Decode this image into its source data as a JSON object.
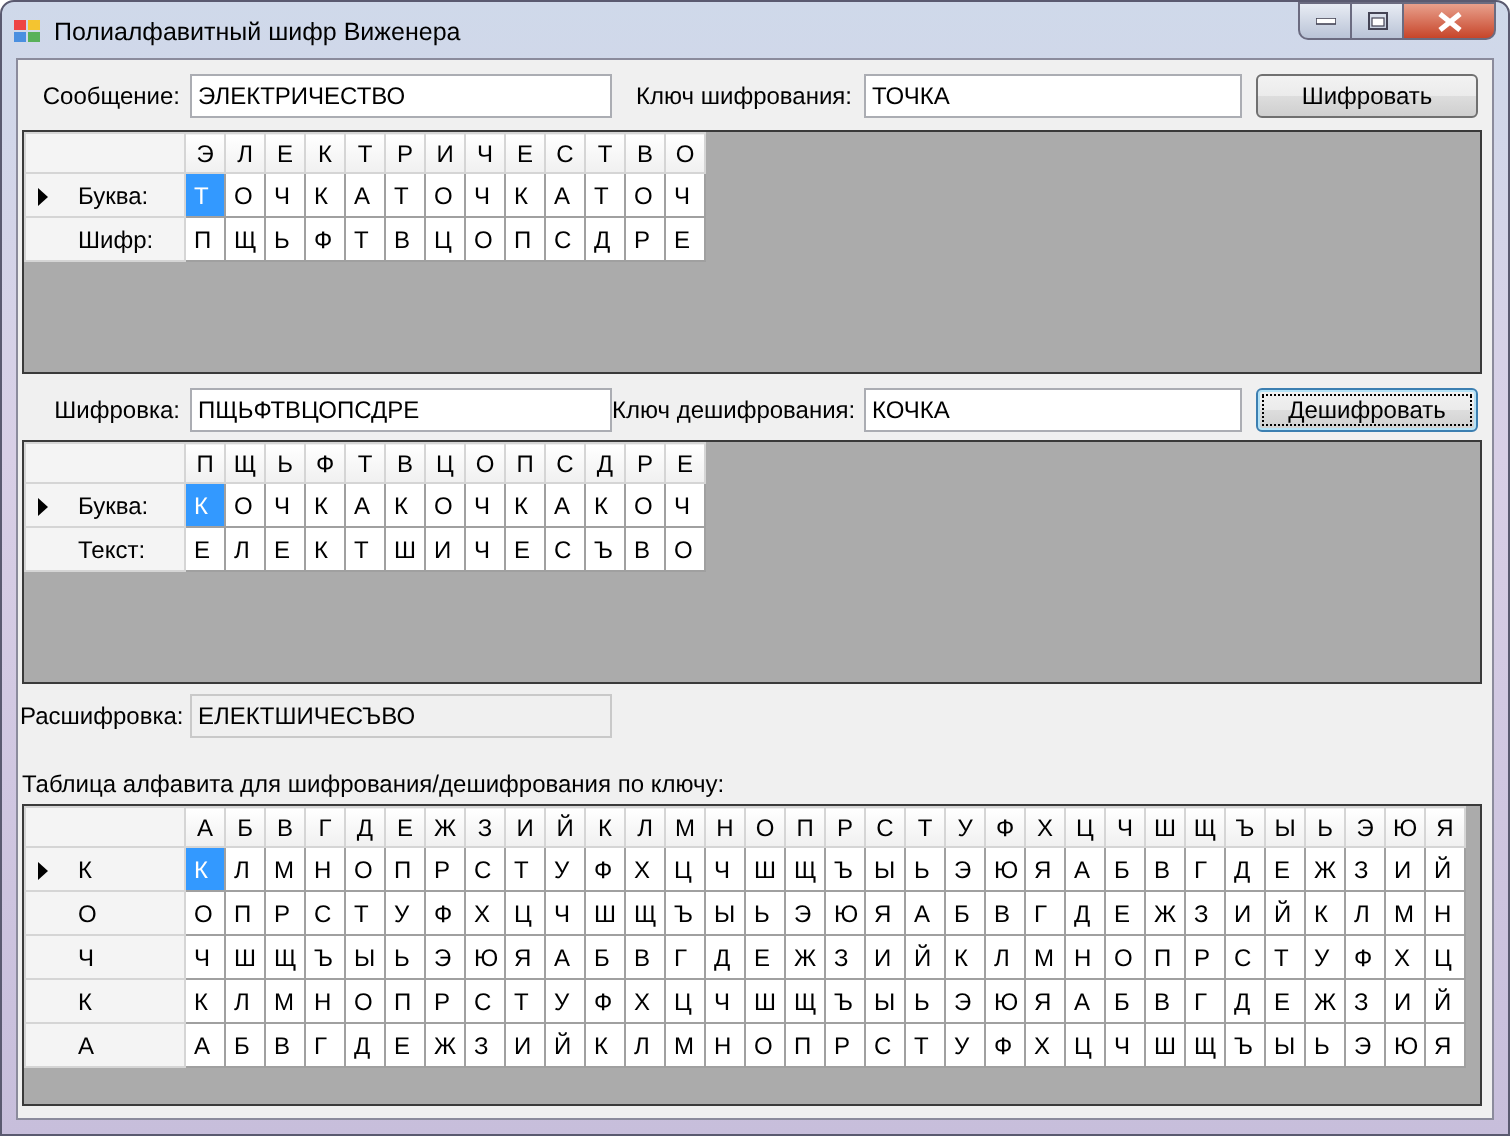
{
  "window": {
    "title": "Полиалфавитный шифр Виженера"
  },
  "encryption": {
    "message": {
      "label": "Сообщение:",
      "value": "ЭЛЕКТРИЧЕСТВО",
      "readonly": false
    },
    "key": {
      "label": "Ключ шифрования:",
      "value": "ТОЧКА",
      "readonly": false
    },
    "button": {
      "label": "Шифровать",
      "focused": false
    },
    "grid": {
      "columns": [
        "Э",
        "Л",
        "Е",
        "К",
        "Т",
        "Р",
        "И",
        "Ч",
        "Е",
        "С",
        "Т",
        "В",
        "О"
      ],
      "rows": [
        {
          "header": "Буква:",
          "selected": true,
          "cells": [
            {
              "text": "Т",
              "selected": true
            },
            {
              "text": "О",
              "selected": false
            },
            {
              "text": "Ч",
              "selected": false
            },
            {
              "text": "К",
              "selected": false
            },
            {
              "text": "А",
              "selected": false
            },
            {
              "text": "Т",
              "selected": false
            },
            {
              "text": "О",
              "selected": false
            },
            {
              "text": "Ч",
              "selected": false
            },
            {
              "text": "К",
              "selected": false
            },
            {
              "text": "А",
              "selected": false
            },
            {
              "text": "Т",
              "selected": false
            },
            {
              "text": "О",
              "selected": false
            },
            {
              "text": "Ч",
              "selected": false
            }
          ]
        },
        {
          "header": "Шифр:",
          "selected": false,
          "cells": [
            {
              "text": "П",
              "selected": false
            },
            {
              "text": "Щ",
              "selected": false
            },
            {
              "text": "Ь",
              "selected": false
            },
            {
              "text": "Ф",
              "selected": false
            },
            {
              "text": "Т",
              "selected": false
            },
            {
              "text": "В",
              "selected": false
            },
            {
              "text": "Ц",
              "selected": false
            },
            {
              "text": "О",
              "selected": false
            },
            {
              "text": "П",
              "selected": false
            },
            {
              "text": "С",
              "selected": false
            },
            {
              "text": "Д",
              "selected": false
            },
            {
              "text": "Р",
              "selected": false
            },
            {
              "text": "Е",
              "selected": false
            }
          ]
        }
      ]
    }
  },
  "decryption": {
    "cipher": {
      "label": "Шифровка:",
      "value": "ПЩЬФТВЦОПСДРЕ",
      "readonly": false
    },
    "key": {
      "label": "Ключ дешифрования:",
      "value": "КОЧКА",
      "readonly": false
    },
    "button": {
      "label": "Дешифровать",
      "focused": true
    },
    "grid": {
      "columns": [
        "П",
        "Щ",
        "Ь",
        "Ф",
        "Т",
        "В",
        "Ц",
        "О",
        "П",
        "С",
        "Д",
        "Р",
        "Е"
      ],
      "rows": [
        {
          "header": "Буква:",
          "selected": true,
          "cells": [
            {
              "text": "К",
              "selected": true
            },
            {
              "text": "О",
              "selected": false
            },
            {
              "text": "Ч",
              "selected": false
            },
            {
              "text": "К",
              "selected": false
            },
            {
              "text": "А",
              "selected": false
            },
            {
              "text": "К",
              "selected": false
            },
            {
              "text": "О",
              "selected": false
            },
            {
              "text": "Ч",
              "selected": false
            },
            {
              "text": "К",
              "selected": false
            },
            {
              "text": "А",
              "selected": false
            },
            {
              "text": "К",
              "selected": false
            },
            {
              "text": "О",
              "selected": false
            },
            {
              "text": "Ч",
              "selected": false
            }
          ]
        },
        {
          "header": "Текст:",
          "selected": false,
          "cells": [
            {
              "text": "Е",
              "selected": false
            },
            {
              "text": "Л",
              "selected": false
            },
            {
              "text": "Е",
              "selected": false
            },
            {
              "text": "К",
              "selected": false
            },
            {
              "text": "Т",
              "selected": false
            },
            {
              "text": "Ш",
              "selected": false
            },
            {
              "text": "И",
              "selected": false
            },
            {
              "text": "Ч",
              "selected": false
            },
            {
              "text": "Е",
              "selected": false
            },
            {
              "text": "С",
              "selected": false
            },
            {
              "text": "Ъ",
              "selected": false
            },
            {
              "text": "В",
              "selected": false
            },
            {
              "text": "О",
              "selected": false
            }
          ]
        }
      ]
    }
  },
  "result": {
    "label": "Расшифровка:",
    "value": "ЕЛЕКТШИЧЕСЪВО",
    "readonly": true
  },
  "alphabet_table": {
    "caption": "Таблица алфавита для шифрования/дешифрования по ключу:",
    "grid": {
      "columns": [
        "А",
        "Б",
        "В",
        "Г",
        "Д",
        "Е",
        "Ж",
        "З",
        "И",
        "Й",
        "К",
        "Л",
        "М",
        "Н",
        "О",
        "П",
        "Р",
        "С",
        "Т",
        "У",
        "Ф",
        "Х",
        "Ц",
        "Ч",
        "Ш",
        "Щ",
        "Ъ",
        "Ы",
        "Ь",
        "Э",
        "Ю",
        "Я"
      ],
      "rows": [
        {
          "header": "К",
          "selected": true,
          "cells": [
            {
              "text": "К",
              "selected": true
            },
            {
              "text": "Л",
              "selected": false
            },
            {
              "text": "М",
              "selected": false
            },
            {
              "text": "Н",
              "selected": false
            },
            {
              "text": "О",
              "selected": false
            },
            {
              "text": "П",
              "selected": false
            },
            {
              "text": "Р",
              "selected": false
            },
            {
              "text": "С",
              "selected": false
            },
            {
              "text": "Т",
              "selected": false
            },
            {
              "text": "У",
              "selected": false
            },
            {
              "text": "Ф",
              "selected": false
            },
            {
              "text": "Х",
              "selected": false
            },
            {
              "text": "Ц",
              "selected": false
            },
            {
              "text": "Ч",
              "selected": false
            },
            {
              "text": "Ш",
              "selected": false
            },
            {
              "text": "Щ",
              "selected": false
            },
            {
              "text": "Ъ",
              "selected": false
            },
            {
              "text": "Ы",
              "selected": false
            },
            {
              "text": "Ь",
              "selected": false
            },
            {
              "text": "Э",
              "selected": false
            },
            {
              "text": "Ю",
              "selected": false
            },
            {
              "text": "Я",
              "selected": false
            },
            {
              "text": "А",
              "selected": false
            },
            {
              "text": "Б",
              "selected": false
            },
            {
              "text": "В",
              "selected": false
            },
            {
              "text": "Г",
              "selected": false
            },
            {
              "text": "Д",
              "selected": false
            },
            {
              "text": "Е",
              "selected": false
            },
            {
              "text": "Ж",
              "selected": false
            },
            {
              "text": "З",
              "selected": false
            },
            {
              "text": "И",
              "selected": false
            },
            {
              "text": "Й",
              "selected": false
            }
          ]
        },
        {
          "header": "О",
          "selected": false,
          "cells": [
            {
              "text": "О",
              "selected": false
            },
            {
              "text": "П",
              "selected": false
            },
            {
              "text": "Р",
              "selected": false
            },
            {
              "text": "С",
              "selected": false
            },
            {
              "text": "Т",
              "selected": false
            },
            {
              "text": "У",
              "selected": false
            },
            {
              "text": "Ф",
              "selected": false
            },
            {
              "text": "Х",
              "selected": false
            },
            {
              "text": "Ц",
              "selected": false
            },
            {
              "text": "Ч",
              "selected": false
            },
            {
              "text": "Ш",
              "selected": false
            },
            {
              "text": "Щ",
              "selected": false
            },
            {
              "text": "Ъ",
              "selected": false
            },
            {
              "text": "Ы",
              "selected": false
            },
            {
              "text": "Ь",
              "selected": false
            },
            {
              "text": "Э",
              "selected": false
            },
            {
              "text": "Ю",
              "selected": false
            },
            {
              "text": "Я",
              "selected": false
            },
            {
              "text": "А",
              "selected": false
            },
            {
              "text": "Б",
              "selected": false
            },
            {
              "text": "В",
              "selected": false
            },
            {
              "text": "Г",
              "selected": false
            },
            {
              "text": "Д",
              "selected": false
            },
            {
              "text": "Е",
              "selected": false
            },
            {
              "text": "Ж",
              "selected": false
            },
            {
              "text": "З",
              "selected": false
            },
            {
              "text": "И",
              "selected": false
            },
            {
              "text": "Й",
              "selected": false
            },
            {
              "text": "К",
              "selected": false
            },
            {
              "text": "Л",
              "selected": false
            },
            {
              "text": "М",
              "selected": false
            },
            {
              "text": "Н",
              "selected": false
            }
          ]
        },
        {
          "header": "Ч",
          "selected": false,
          "cells": [
            {
              "text": "Ч",
              "selected": false
            },
            {
              "text": "Ш",
              "selected": false
            },
            {
              "text": "Щ",
              "selected": false
            },
            {
              "text": "Ъ",
              "selected": false
            },
            {
              "text": "Ы",
              "selected": false
            },
            {
              "text": "Ь",
              "selected": false
            },
            {
              "text": "Э",
              "selected": false
            },
            {
              "text": "Ю",
              "selected": false
            },
            {
              "text": "Я",
              "selected": false
            },
            {
              "text": "А",
              "selected": false
            },
            {
              "text": "Б",
              "selected": false
            },
            {
              "text": "В",
              "selected": false
            },
            {
              "text": "Г",
              "selected": false
            },
            {
              "text": "Д",
              "selected": false
            },
            {
              "text": "Е",
              "selected": false
            },
            {
              "text": "Ж",
              "selected": false
            },
            {
              "text": "З",
              "selected": false
            },
            {
              "text": "И",
              "selected": false
            },
            {
              "text": "Й",
              "selected": false
            },
            {
              "text": "К",
              "selected": false
            },
            {
              "text": "Л",
              "selected": false
            },
            {
              "text": "М",
              "selected": false
            },
            {
              "text": "Н",
              "selected": false
            },
            {
              "text": "О",
              "selected": false
            },
            {
              "text": "П",
              "selected": false
            },
            {
              "text": "Р",
              "selected": false
            },
            {
              "text": "С",
              "selected": false
            },
            {
              "text": "Т",
              "selected": false
            },
            {
              "text": "У",
              "selected": false
            },
            {
              "text": "Ф",
              "selected": false
            },
            {
              "text": "Х",
              "selected": false
            },
            {
              "text": "Ц",
              "selected": false
            }
          ]
        },
        {
          "header": "К",
          "selected": false,
          "cells": [
            {
              "text": "К",
              "selected": false
            },
            {
              "text": "Л",
              "selected": false
            },
            {
              "text": "М",
              "selected": false
            },
            {
              "text": "Н",
              "selected": false
            },
            {
              "text": "О",
              "selected": false
            },
            {
              "text": "П",
              "selected": false
            },
            {
              "text": "Р",
              "selected": false
            },
            {
              "text": "С",
              "selected": false
            },
            {
              "text": "Т",
              "selected": false
            },
            {
              "text": "У",
              "selected": false
            },
            {
              "text": "Ф",
              "selected": false
            },
            {
              "text": "Х",
              "selected": false
            },
            {
              "text": "Ц",
              "selected": false
            },
            {
              "text": "Ч",
              "selected": false
            },
            {
              "text": "Ш",
              "selected": false
            },
            {
              "text": "Щ",
              "selected": false
            },
            {
              "text": "Ъ",
              "selected": false
            },
            {
              "text": "Ы",
              "selected": false
            },
            {
              "text": "Ь",
              "selected": false
            },
            {
              "text": "Э",
              "selected": false
            },
            {
              "text": "Ю",
              "selected": false
            },
            {
              "text": "Я",
              "selected": false
            },
            {
              "text": "А",
              "selected": false
            },
            {
              "text": "Б",
              "selected": false
            },
            {
              "text": "В",
              "selected": false
            },
            {
              "text": "Г",
              "selected": false
            },
            {
              "text": "Д",
              "selected": false
            },
            {
              "text": "Е",
              "selected": false
            },
            {
              "text": "Ж",
              "selected": false
            },
            {
              "text": "З",
              "selected": false
            },
            {
              "text": "И",
              "selected": false
            },
            {
              "text": "Й",
              "selected": false
            }
          ]
        },
        {
          "header": "А",
          "selected": false,
          "cells": [
            {
              "text": "А",
              "selected": false
            },
            {
              "text": "Б",
              "selected": false
            },
            {
              "text": "В",
              "selected": false
            },
            {
              "text": "Г",
              "selected": false
            },
            {
              "text": "Д",
              "selected": false
            },
            {
              "text": "Е",
              "selected": false
            },
            {
              "text": "Ж",
              "selected": false
            },
            {
              "text": "З",
              "selected": false
            },
            {
              "text": "И",
              "selected": false
            },
            {
              "text": "Й",
              "selected": false
            },
            {
              "text": "К",
              "selected": false
            },
            {
              "text": "Л",
              "selected": false
            },
            {
              "text": "М",
              "selected": false
            },
            {
              "text": "Н",
              "selected": false
            },
            {
              "text": "О",
              "selected": false
            },
            {
              "text": "П",
              "selected": false
            },
            {
              "text": "Р",
              "selected": false
            },
            {
              "text": "С",
              "selected": false
            },
            {
              "text": "Т",
              "selected": false
            },
            {
              "text": "У",
              "selected": false
            },
            {
              "text": "Ф",
              "selected": false
            },
            {
              "text": "Х",
              "selected": false
            },
            {
              "text": "Ц",
              "selected": false
            },
            {
              "text": "Ч",
              "selected": false
            },
            {
              "text": "Ш",
              "selected": false
            },
            {
              "text": "Щ",
              "selected": false
            },
            {
              "text": "Ъ",
              "selected": false
            },
            {
              "text": "Ы",
              "selected": false
            },
            {
              "text": "Ь",
              "selected": false
            },
            {
              "text": "Э",
              "selected": false
            },
            {
              "text": "Ю",
              "selected": false
            },
            {
              "text": "Я",
              "selected": false
            }
          ]
        }
      ]
    }
  }
}
